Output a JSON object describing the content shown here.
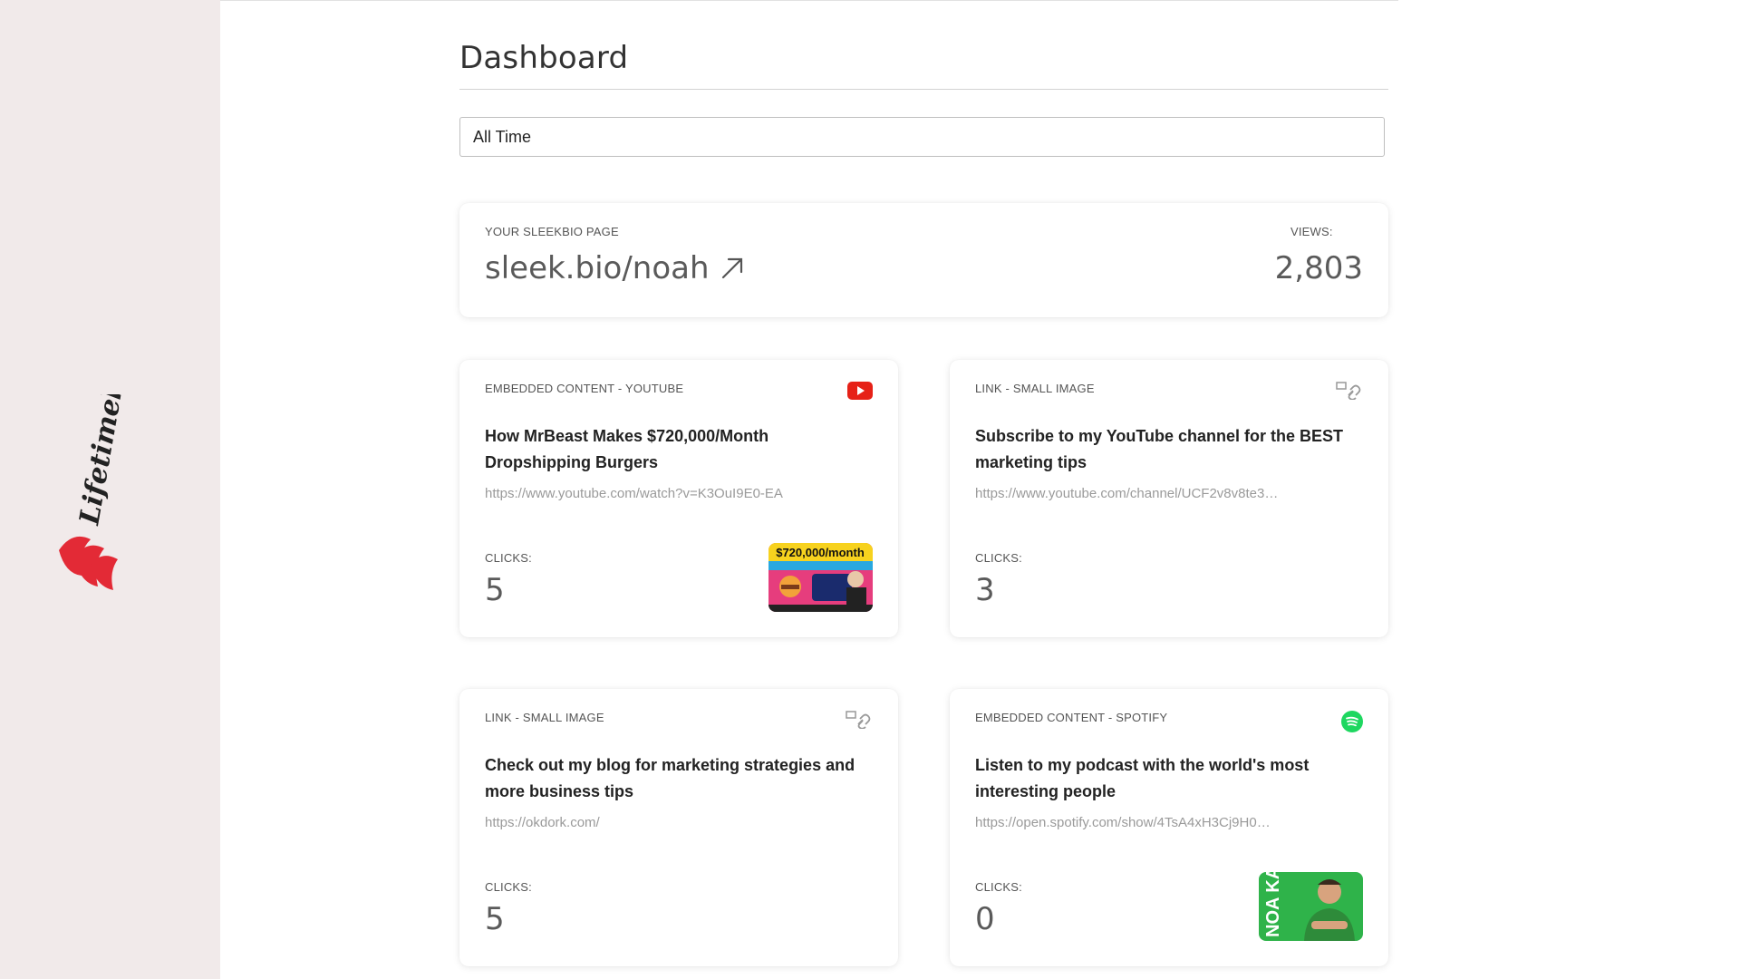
{
  "brand": {
    "name": "Lifetimebies",
    "accent": "#e32a36"
  },
  "header": {
    "title": "Dashboard"
  },
  "filter": {
    "selected": "All Time"
  },
  "overview": {
    "page_caption": "YOUR SLEEKBIO PAGE",
    "page_url": "sleek.bio/noah",
    "views_caption": "VIEWS:",
    "views": "2,803"
  },
  "items": [
    {
      "type": "EMBEDDED CONTENT - YOUTUBE",
      "icon": "youtube-icon",
      "title": "How MrBeast Makes $720,000/Month Dropshipping Burgers",
      "url": "https://www.youtube.com/watch?v=K3OuI9E0-EA",
      "clicks_caption": "CLICKS:",
      "clicks": "5",
      "thumb_text": "$720,000/month"
    },
    {
      "type": "LINK - SMALL IMAGE",
      "icon": "link-image-icon",
      "title": "Subscribe to my YouTube channel for the BEST marketing tips",
      "url": "https://www.youtube.com/channel/UCF2v8v8te3…",
      "clicks_caption": "CLICKS:",
      "clicks": "3"
    },
    {
      "type": "LINK - SMALL IMAGE",
      "icon": "link-image-icon",
      "title": "Check out my blog for marketing strategies and more business tips",
      "url": "https://okdork.com/",
      "clicks_caption": "CLICKS:",
      "clicks": "5"
    },
    {
      "type": "EMBEDDED CONTENT - SPOTIFY",
      "icon": "spotify-icon",
      "title": "Listen to my podcast with the world's most interesting people",
      "url": "https://open.spotify.com/show/4TsA4xH3Cj9H0…",
      "clicks_caption": "CLICKS:",
      "clicks": "0",
      "thumb_text": "NOA KAGA"
    }
  ],
  "colors": {
    "youtube_red": "#e62117",
    "spotify_green": "#1ed760",
    "sidebar_bg": "#f1eaea"
  }
}
